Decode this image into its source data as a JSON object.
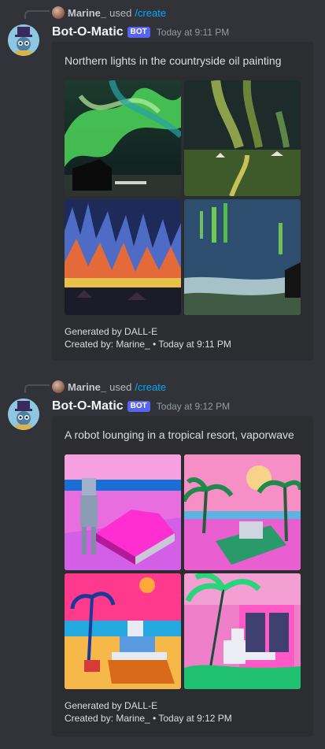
{
  "messages": [
    {
      "reply": {
        "user": "Marine_",
        "used": "used",
        "command": "/create"
      },
      "author": {
        "name": "Bot-O-Matic",
        "tag": "BOT",
        "timestamp": "Today at 9:11 PM"
      },
      "embed": {
        "prompt": "Northern lights in the countryside oil painting",
        "generated_by": "Generated by DALL-E",
        "created_by": "Created by: Marine_ • Today at 9:11 PM"
      }
    },
    {
      "reply": {
        "user": "Marine_",
        "used": "used",
        "command": "/create"
      },
      "author": {
        "name": "Bot-O-Matic",
        "tag": "BOT",
        "timestamp": "Today at 9:12 PM"
      },
      "embed": {
        "prompt": "A robot lounging in a tropical resort, vaporwave",
        "generated_by": "Generated by DALL-E",
        "created_by": "Created by: Marine_ • Today at 9:12 PM"
      }
    }
  ],
  "colors": {
    "background": "#313338",
    "embed_background": "#2b2d31",
    "bot_tag": "#5865f2",
    "command_link": "#00a8fc"
  }
}
